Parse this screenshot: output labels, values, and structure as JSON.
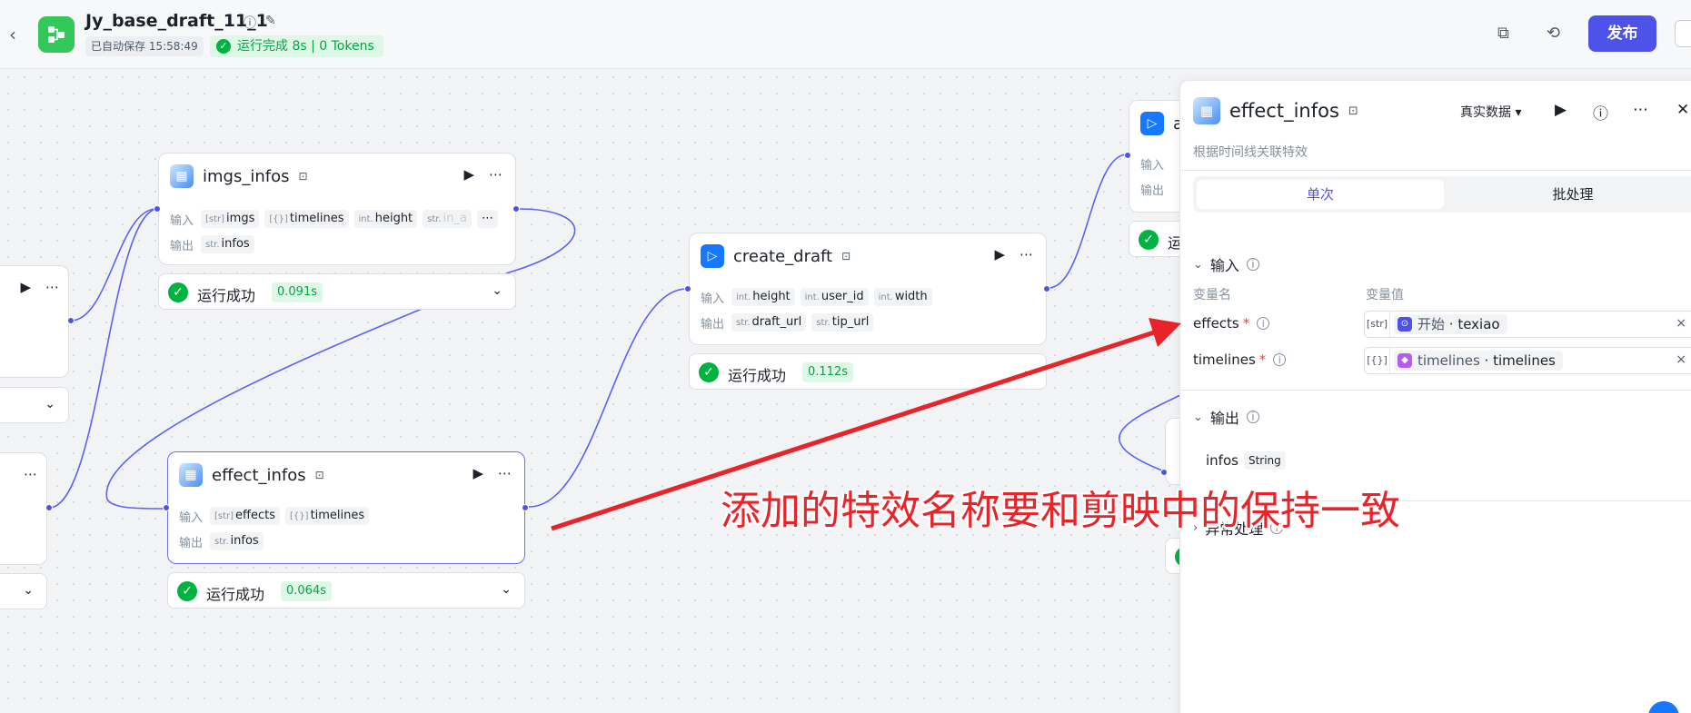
{
  "header": {
    "back_icon": "chevron-left-icon",
    "app_title": "Jy_base_draft_11_1",
    "autosave": "已自动保存 15:58:49",
    "run_status": "运行完成 8s | 0 Tokens",
    "publish_label": "发布"
  },
  "nodes": {
    "imgs_infos": {
      "title": "imgs_infos",
      "input_label": "输入",
      "output_label": "输出",
      "inputs": [
        {
          "type": "[str]",
          "name": "imgs"
        },
        {
          "type": "[{}]",
          "name": "timelines"
        },
        {
          "type": "int.",
          "name": "height"
        },
        {
          "type": "str.",
          "name": "in_a"
        }
      ],
      "outputs": [
        {
          "type": "str.",
          "name": "infos"
        }
      ],
      "status": "运行成功",
      "time": "0.091s"
    },
    "create_draft": {
      "title": "create_draft",
      "input_label": "输入",
      "output_label": "输出",
      "inputs": [
        {
          "type": "int.",
          "name": "height"
        },
        {
          "type": "int.",
          "name": "user_id"
        },
        {
          "type": "int.",
          "name": "width"
        }
      ],
      "outputs": [
        {
          "type": "str.",
          "name": "draft_url"
        },
        {
          "type": "str.",
          "name": "tip_url"
        }
      ],
      "status": "运行成功",
      "time": "0.112s"
    },
    "effect_infos": {
      "title": "effect_infos",
      "input_label": "输入",
      "output_label": "输出",
      "inputs": [
        {
          "type": "[str]",
          "name": "effects"
        },
        {
          "type": "[{}]",
          "name": "timelines"
        }
      ],
      "outputs": [
        {
          "type": "str.",
          "name": "infos"
        }
      ],
      "status": "运行成功",
      "time": "0.064s"
    },
    "partial_right": {
      "title": "a",
      "input_label": "输入",
      "output_label": "输出",
      "status": "运"
    }
  },
  "panel": {
    "title": "effect_infos",
    "description": "根据时间线关联特效",
    "data_mode": "真实数据",
    "tabs": [
      "单次",
      "批处理"
    ],
    "input_section": "输入",
    "col_name": "变量名",
    "col_value": "变量值",
    "inputs": [
      {
        "name": "effects",
        "type": "[str]",
        "source": "开始",
        "value": "texiao",
        "icon_color": "#4d53e8"
      },
      {
        "name": "timelines",
        "type": "[{}]",
        "source": "timelines",
        "value": "timelines",
        "icon_color": "#b35cf0"
      }
    ],
    "output_section": "输出",
    "outputs": [
      {
        "name": "infos",
        "type": "String"
      }
    ],
    "error_section": "异常处理"
  },
  "annotation": {
    "text": "添加的特效名称要和剪映中的保持一致",
    "color": "#e8242b"
  }
}
